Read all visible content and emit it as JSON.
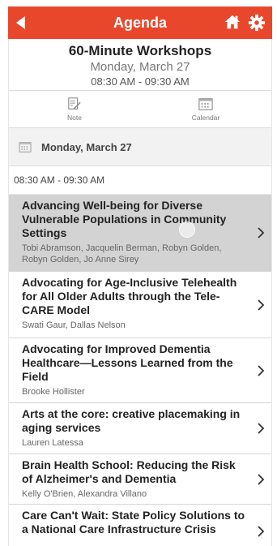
{
  "header": {
    "title": "Agenda",
    "back_icon": "back-arrow-icon",
    "home_icon": "home-icon",
    "settings_icon": "gear-icon",
    "color": "#e8472b"
  },
  "session": {
    "title": "60-Minute Workshops",
    "date": "Monday, March  27",
    "time": "08:30 AM - 09:30 AM"
  },
  "actions": [
    {
      "label": "Note",
      "icon": "note-icon"
    },
    {
      "label": "Calendar",
      "icon": "calendar-icon"
    }
  ],
  "day": {
    "label": "Monday, March  27",
    "icon": "calendar-icon"
  },
  "timeslot": "08:30 AM - 09:30 AM",
  "items": [
    {
      "title": "Advancing Well-being for Diverse Vulnerable Populations in Community Settings",
      "authors": "Tobi Abramson, Jacquelin Berman, Robyn Golden, Robyn Golden, Jo Anne Sirey",
      "selected": true
    },
    {
      "title": "Advocating for Age-Inclusive Telehealth for All Older Adults through the Tele-CARE Model",
      "authors": "Swati Gaur, Dallas Nelson"
    },
    {
      "title": "Advocating for Improved Dementia Healthcare—Lessons Learned from the Field",
      "authors": "Brooke Hollister"
    },
    {
      "title": "Arts at the core: creative placemaking in aging services",
      "authors": "Lauren Latessa"
    },
    {
      "title": "Brain Health School: Reducing the Risk of Alzheimer's and Dementia",
      "authors": "Kelly O'Brien, Alexandra Villano"
    },
    {
      "title": "Care Can't Wait: State Policy Solutions to a National Care Infrastructure Crisis",
      "authors": ""
    }
  ]
}
